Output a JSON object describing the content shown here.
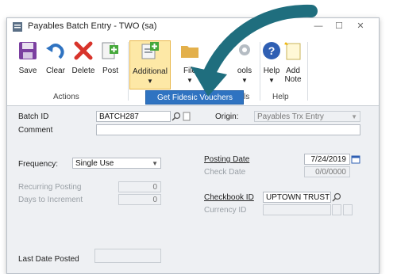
{
  "window": {
    "title": "Payables Batch Entry  -  TWO (sa)",
    "minimize": "—",
    "maximize": "☐",
    "close": "✕"
  },
  "ribbon": {
    "save": "Save",
    "clear": "Clear",
    "delete": "Delete",
    "post": "Post",
    "additional": "Additional",
    "file": "File",
    "tools": "ools",
    "help": "Help",
    "add_note": "Add\nNote",
    "group_actions": "Actions",
    "group_tools": "ls",
    "group_help": "Help",
    "dropdown_item": "Get Fidesic Vouchers"
  },
  "form": {
    "batch_id_label": "Batch ID",
    "batch_id_value": "BATCH287",
    "origin_label": "Origin:",
    "origin_value": "Payables Trx Entry",
    "comment_label": "Comment",
    "frequency_label": "Frequency:",
    "frequency_value": "Single Use",
    "recurring_posting_label": "Recurring Posting",
    "recurring_posting_value": "0",
    "days_to_increment_label": "Days to Increment",
    "days_to_increment_value": "0",
    "posting_date_label": "Posting Date",
    "posting_date_value": "7/24/2019",
    "check_date_label": "Check Date",
    "check_date_value": "0/0/0000",
    "checkbook_id_label": "Checkbook ID",
    "checkbook_id_value": "UPTOWN TRUST",
    "currency_id_label": "Currency ID",
    "last_date_posted_label": "Last Date Posted"
  },
  "colors": {
    "accent_arrow": "#1f6e7e",
    "selected_button": "#fde8a6",
    "dropdown": "#2f73c1"
  }
}
